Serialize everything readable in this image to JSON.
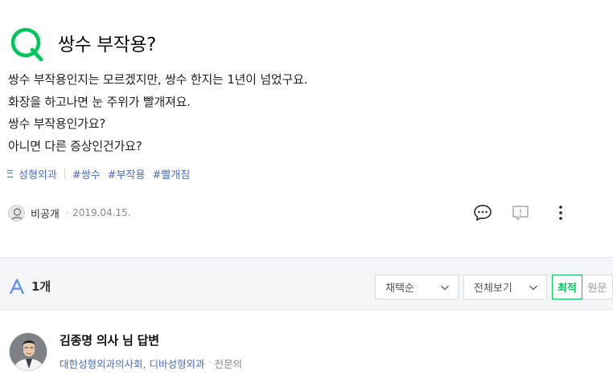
{
  "question": {
    "mark_icon": "q-mark-icon",
    "title": "쌍수 부작용?",
    "body_lines": [
      "쌍수 부작용인지는 모르겠지만, 쌍수 한지는 1년이 넘었구요.",
      "화장을 하고나면 눈 주위가 빨개져요.",
      "쌍수 부작용인가요?",
      "아니면 다른 증상인건가요?"
    ],
    "category": "성형외과",
    "tags": [
      "#쌍수",
      "#부작용",
      "#빨개짐"
    ],
    "author": "비공개",
    "date": "2019.04.15.",
    "actions": {
      "comment_icon": "comment-icon",
      "report_icon": "report-icon",
      "more_icon": "more-vertical-icon"
    }
  },
  "answers_header": {
    "mark_icon": "a-mark-icon",
    "count_label": "1개",
    "sort_select": "채택순",
    "view_select": "전체보기",
    "toggle": {
      "on": "최적",
      "off": "원문"
    }
  },
  "answer": {
    "name": "김종명 의사 님 답변",
    "affiliation": "대한성형외과의사회, 디바성형외과",
    "role": "전문의"
  },
  "colors": {
    "brand_green": "#03c75a",
    "link_blue": "#4a6cc9",
    "band_gray": "#f4f5f7"
  }
}
